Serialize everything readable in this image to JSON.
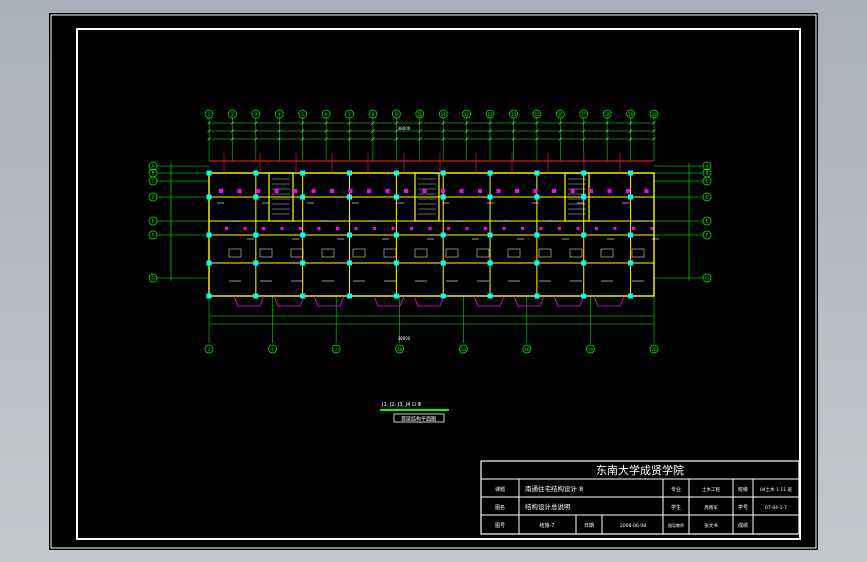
{
  "drawing": {
    "grid_axes_top": [
      "1",
      "2",
      "3",
      "4",
      "5",
      "6",
      "7",
      "8",
      "9",
      "10",
      "11",
      "12",
      "13",
      "14",
      "15",
      "16",
      "17",
      "18",
      "19",
      "20"
    ],
    "grid_axes_bottom": [
      "1",
      "4",
      "7",
      "10",
      "13",
      "16",
      "19",
      "20"
    ],
    "grid_axes_side": [
      "A",
      "B",
      "C",
      "D",
      "E",
      "F",
      "G"
    ],
    "total_dimension": "38000",
    "legend_text": "J1, J2, J3, J4 ⊡ Φ",
    "section_label": "首层结构平面图"
  },
  "title_block": {
    "school": "东南大学成贤学院",
    "row1": {
      "label": "课题",
      "project": "南通住宅结构设计 8",
      "major_label": "专业",
      "major": "土木工程",
      "class_label": "班级",
      "class_value": "04土木 1 11 班"
    },
    "row2": {
      "label": "图名",
      "title": "结构设计总说明",
      "student_label": "学生",
      "student": "周晓军",
      "no_label": "学号",
      "no_value": "07-04-1-7"
    },
    "row3": {
      "label": "图号",
      "number": "结施-7",
      "date_label": "日期",
      "date": "2008-06-08",
      "tutor_label": "指导教师",
      "tutor": "张文书",
      "grade_label": "成绩",
      "grade": ""
    }
  },
  "colors": {
    "background": "#000000",
    "frame": "#ffffff",
    "axis": "#00ff00",
    "wall": "#ffff00",
    "column": "#00ffff",
    "magenta": "#ff00ff",
    "red": "#ff2020"
  }
}
